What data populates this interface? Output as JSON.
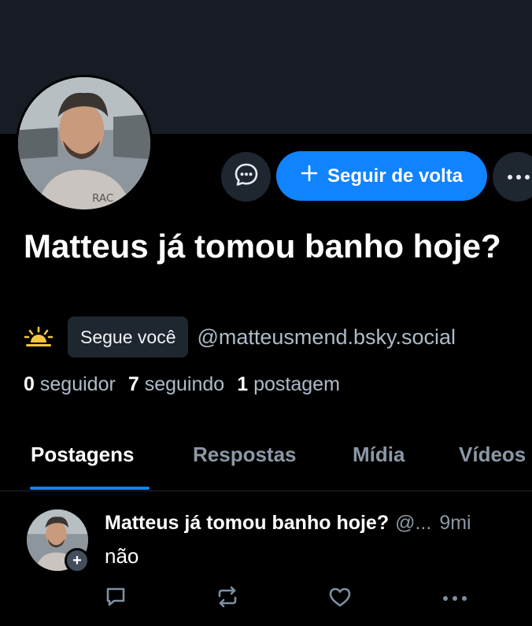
{
  "profile": {
    "display_name": "Matteus já tomou banho hoje?",
    "follows_you_label": "Segue você",
    "handle": "@matteusmend.bsky.social",
    "status_icon": "sun-icon",
    "stats": [
      {
        "count": "0",
        "label": "seguidor"
      },
      {
        "count": "7",
        "label": "seguindo"
      },
      {
        "count": "1",
        "label": "postagem"
      }
    ],
    "avatar_icon": "avatar-photo"
  },
  "actions": {
    "message_icon": "message-bubble-icon",
    "follow_back_label": "Seguir de volta",
    "more_icon": "more-dots-icon"
  },
  "tabs": [
    {
      "label": "Postagens",
      "active": true
    },
    {
      "label": "Respostas",
      "active": false
    },
    {
      "label": "Mídia",
      "active": false
    },
    {
      "label": "Vídeos",
      "active": false
    }
  ],
  "post": {
    "author": "Matteus já tomou banho hoje?",
    "handle": "@...",
    "time": "9mi",
    "text": "não",
    "action_icons": [
      "reply-icon",
      "repost-icon",
      "like-icon",
      "more-dots-icon"
    ]
  },
  "colors": {
    "accent": "#1083fe",
    "background": "#000000",
    "banner": "#171c24",
    "muted_text": "#aebbc9",
    "chip_bg": "#1e2630",
    "sun": "#f5c542"
  }
}
